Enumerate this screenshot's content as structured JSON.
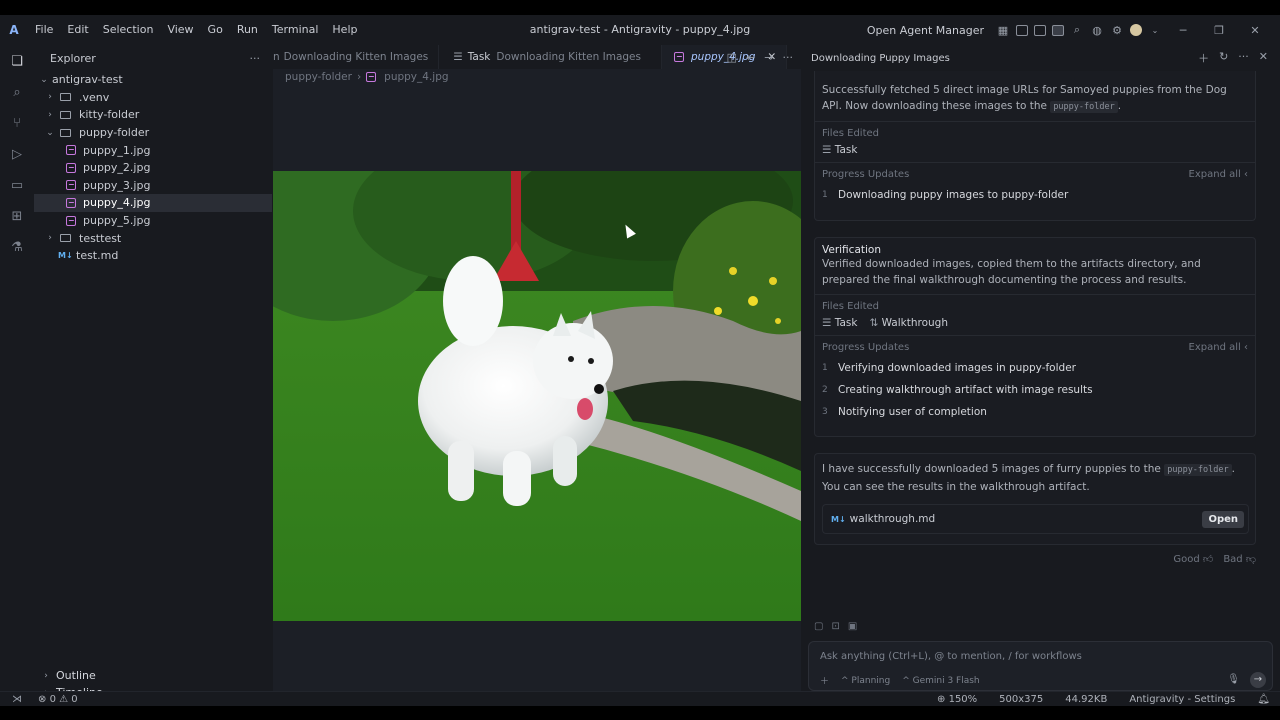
{
  "titlebar": {
    "logo": "A",
    "menu": [
      "File",
      "Edit",
      "Selection",
      "View",
      "Go",
      "Run",
      "Terminal",
      "Help"
    ],
    "title": "antigrav-test - Antigravity - puppy_4.jpg",
    "open_agent_manager": "Open Agent Manager"
  },
  "explorer": {
    "header": "Explorer",
    "root": "antigrav-test",
    "items": [
      {
        "name": ".venv",
        "type": "folder",
        "indent": 1
      },
      {
        "name": "kitty-folder",
        "type": "folder",
        "indent": 1
      },
      {
        "name": "puppy-folder",
        "type": "folder-open",
        "indent": 1
      },
      {
        "name": "puppy_1.jpg",
        "type": "image",
        "indent": 2
      },
      {
        "name": "puppy_2.jpg",
        "type": "image",
        "indent": 2
      },
      {
        "name": "puppy_3.jpg",
        "type": "image",
        "indent": 2
      },
      {
        "name": "puppy_4.jpg",
        "type": "image",
        "indent": 2,
        "selected": true
      },
      {
        "name": "puppy_5.jpg",
        "type": "image",
        "indent": 2
      },
      {
        "name": "testtest",
        "type": "folder",
        "indent": 1
      },
      {
        "name": "test.md",
        "type": "markdown",
        "indent": 1
      }
    ],
    "outline": "Outline",
    "timeline": "Timeline"
  },
  "editor": {
    "tabs": [
      {
        "label": "Downloading Kitten Images",
        "prefix": "n"
      },
      {
        "label": "Downloading Kitten Images",
        "prefix": "Task"
      },
      {
        "label": "puppy_4.jpg",
        "prefix": ""
      }
    ],
    "breadcrumb": [
      "puppy-folder",
      "puppy_4.jpg"
    ]
  },
  "agent": {
    "title": "Downloading Puppy Images",
    "step1": {
      "body_pre": "Successfully fetched 5 direct image URLs for Samoyed puppies from the Dog API. Now downloading these images to the",
      "body_code": "puppy-folder",
      "files_edited": "Files Edited",
      "file": "Task",
      "progress_updates": "Progress Updates",
      "expand_all": "Expand all",
      "progress": [
        "Downloading puppy images to puppy-folder"
      ]
    },
    "step2": {
      "title": "Verification",
      "body": "Verified downloaded images, copied them to the artifacts directory, and prepared the final walkthrough documenting the process and results.",
      "files_edited": "Files Edited",
      "files": [
        "Task",
        "Walkthrough"
      ],
      "progress_updates": "Progress Updates",
      "expand_all": "Expand all",
      "progress": [
        "Verifying downloaded images in puppy-folder",
        "Creating walkthrough artifact with image results",
        "Notifying user of completion"
      ]
    },
    "final": {
      "body_pre": "I have successfully downloaded 5 images of furry puppies to the",
      "body_code": "puppy-folder",
      "body_post": ". You can see the results in the walkthrough artifact.",
      "artifact": "walkthrough.md",
      "open": "Open"
    },
    "feedback": {
      "good": "Good",
      "bad": "Bad"
    },
    "input": {
      "placeholder": "Ask anything (Ctrl+L), @ to mention, / for workflows",
      "mode": "Planning",
      "model": "Gemini 3 Flash"
    }
  },
  "status": {
    "errors": "0",
    "warnings": "0",
    "zoom": "150%",
    "dimensions": "500x375",
    "filesize": "44.92KB",
    "settings": "Antigravity - Settings"
  }
}
